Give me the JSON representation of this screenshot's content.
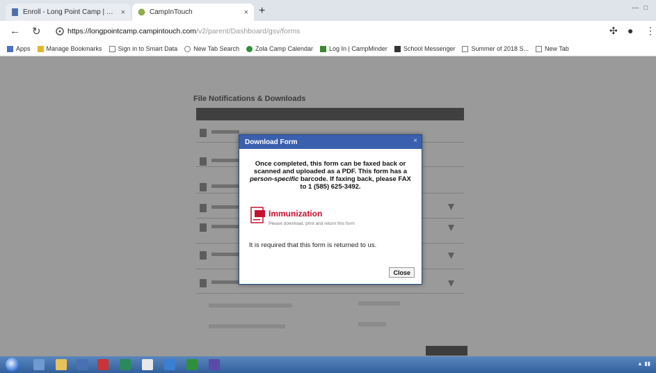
{
  "browser": {
    "tabs": [
      {
        "title": "Enroll - Long Point Camp | The",
        "close": "×",
        "active": false,
        "favicon_color": "#4f6fa8"
      },
      {
        "title": "CampInTouch",
        "close": "×",
        "active": true,
        "favicon_color": "#8fae4a"
      }
    ],
    "new_tab": "+",
    "address": {
      "host": "https://longpointcamp.campintouch.com",
      "path": "/v2/parent/Dashboard/gsv/forms"
    },
    "bookmarks": [
      {
        "label": "Apps",
        "color": "#4a72c4"
      },
      {
        "label": "Manage Bookmarks",
        "color": "#e4b62b"
      },
      {
        "label": "Sign in to Smart Data",
        "color": "#777777"
      },
      {
        "label": "New Tab Search",
        "color": "#777777"
      },
      {
        "label": "Zola Camp Calendar",
        "color": "#2f8f3a"
      },
      {
        "label": "Log In | CampMinder",
        "color": "#3a8a2f"
      },
      {
        "label": "School Messenger",
        "color": "#333333"
      },
      {
        "label": "Summer of 2018 S...",
        "color": "#777777"
      },
      {
        "label": "New Tab",
        "color": "#777777"
      }
    ]
  },
  "page": {
    "section_title": "File Notifications & Downloads"
  },
  "modal": {
    "title": "Download Form",
    "close_x": "×",
    "message_part1": "Once completed, this form can be faxed back or scanned and uploaded as a PDF. This form has a",
    "message_emph": "person-specific",
    "message_part2": "barcode. If faxing back, please FAX to 1 (585) 625-3492.",
    "document_title": "Immunization",
    "document_sub": "Please download, print and return this form",
    "note": "It is required that this form is returned to us.",
    "close_button": "Close"
  },
  "colors": {
    "dialog_header": "#3a5fae",
    "document_accent": "#c8102e",
    "overlay": "#9a9a9a"
  }
}
